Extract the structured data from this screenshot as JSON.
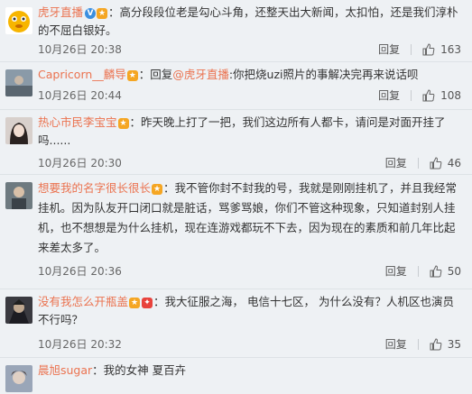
{
  "comments": [
    {
      "user": "虎牙直播",
      "text": "：高分段段位老是勾心斗角，还整天出大新闻，太扣怕，还是我们淳朴的不屈白银好。",
      "time": "10月26日 20:38",
      "reply": "回复",
      "likes": "163",
      "badges": [
        "verified-icon",
        "level-badge-icon"
      ]
    },
    {
      "user": "Capricorn__麟导",
      "text": "：回复",
      "mention": "@虎牙直播",
      "text2": ":你把烧uzi照片的事解决完再来说话呗",
      "time": "10月26日 20:44",
      "reply": "回复",
      "likes": "108"
    },
    {
      "user": "热心市民李宝宝",
      "text": "：昨天晚上打了一把，我们这边所有人都卡，请问是对面开挂了吗......",
      "time": "10月26日 20:30",
      "reply": "回复",
      "likes": "46"
    },
    {
      "user": "想要我的名字很长很长",
      "text": "：我不管你封不封我的号，我就是刚刚挂机了，并且我经常挂机。因为队友开口闭口就是脏话，骂爹骂娘，你们不管这种现象，只知道封别人挂机，也不想想是为什么挂机，现在连游戏都玩不下去，因为现在的素质和前几年比起来差太多了。",
      "time": "10月26日 20:36",
      "reply": "回复",
      "likes": "50"
    },
    {
      "user": "没有我怎么开瓶盖",
      "text": "：我大征服之海， 电信十七区， 为什么没有？人机区也演员不行吗？",
      "time": "10月26日 20:32",
      "reply": "回复",
      "likes": "35"
    },
    {
      "user": "晨旭sugar",
      "text": "：我的女神 夏百卉"
    }
  ],
  "colors": {
    "username": "#eb7350",
    "background": "#eef1f4"
  }
}
